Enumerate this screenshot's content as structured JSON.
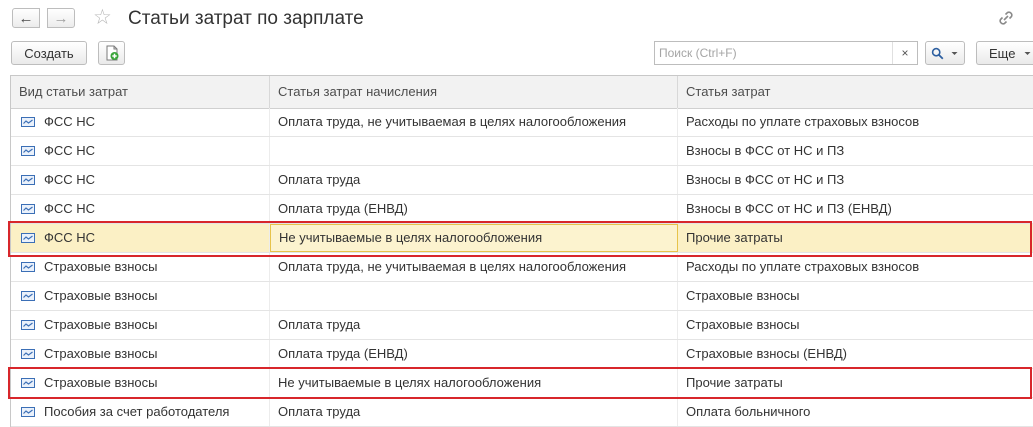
{
  "window": {
    "title": "Статьи затрат по зарплате"
  },
  "toolbar": {
    "create_label": "Создать",
    "search_placeholder": "Поиск (Ctrl+F)",
    "search_value": "",
    "clear_label": "×",
    "more_label": "Еще"
  },
  "table": {
    "columns": [
      "Вид статьи затрат",
      "Статья затрат начисления",
      "Статья затрат"
    ],
    "rows": [
      {
        "kind": "ФСС НС",
        "accrual": "Оплата труда, не учитываемая в целях налогообложения",
        "cost": "Расходы по уплате страховых взносов"
      },
      {
        "kind": "ФСС НС",
        "accrual": "",
        "cost": "Взносы в ФСС от НС и ПЗ"
      },
      {
        "kind": "ФСС НС",
        "accrual": "Оплата труда",
        "cost": "Взносы в ФСС от НС и ПЗ"
      },
      {
        "kind": "ФСС НС",
        "accrual": "Оплата труда (ЕНВД)",
        "cost": "Взносы в ФСС от НС и ПЗ (ЕНВД)"
      },
      {
        "kind": "ФСС НС",
        "accrual": "Не учитываемые в целях налогообложения",
        "cost": "Прочие затраты"
      },
      {
        "kind": "Страховые взносы",
        "accrual": "Оплата труда, не учитываемая в целях налогообложения",
        "cost": "Расходы по уплате страховых взносов"
      },
      {
        "kind": "Страховые взносы",
        "accrual": "",
        "cost": "Страховые взносы"
      },
      {
        "kind": "Страховые взносы",
        "accrual": "Оплата труда",
        "cost": "Страховые взносы"
      },
      {
        "kind": "Страховые взносы",
        "accrual": "Оплата труда (ЕНВД)",
        "cost": "Страховые взносы (ЕНВД)"
      },
      {
        "kind": "Страховые взносы",
        "accrual": "Не учитываемые в целях налогообложения",
        "cost": "Прочие затраты"
      },
      {
        "kind": "Пособия за счет работодателя",
        "accrual": "Оплата труда",
        "cost": "Оплата больничного"
      }
    ]
  },
  "colors": {
    "selected_row": "#fbf0c5",
    "focus_border": "#e7c34a",
    "highlight_frame": "#d8262b",
    "row_icon": "#3b6fb6"
  }
}
